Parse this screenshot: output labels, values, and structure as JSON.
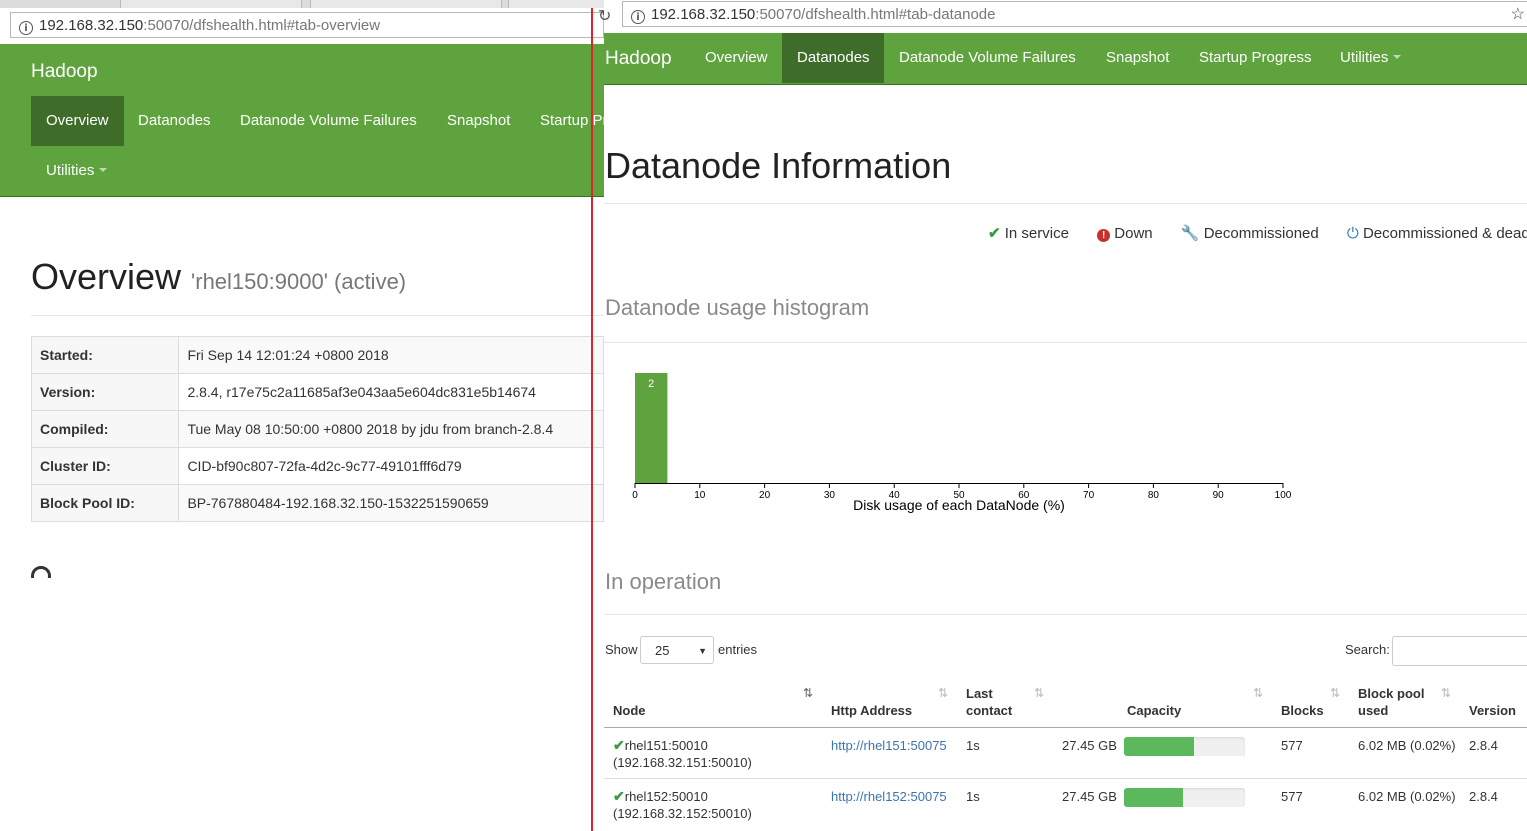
{
  "left": {
    "url_host": "192.168.32.150",
    "url_rest": ":50070/dfshealth.html#tab-overview",
    "brand": "Hadoop",
    "nav": [
      {
        "label": "Overview",
        "active": true
      },
      {
        "label": "Datanodes"
      },
      {
        "label": "Datanode Volume Failures"
      },
      {
        "label": "Snapshot"
      },
      {
        "label": "Startup Pr"
      },
      {
        "label": "Utilities"
      }
    ],
    "title": "Overview",
    "subtitle": "'rhel150:9000' (active)",
    "info": [
      {
        "key": "Started:",
        "value": "Fri Sep 14 12:01:24 +0800 2018"
      },
      {
        "key": "Version:",
        "value": "2.8.4, r17e75c2a11685af3e043aa5e604dc831e5b14674"
      },
      {
        "key": "Compiled:",
        "value": "Tue May 08 10:50:00 +0800 2018 by jdu from branch-2.8.4"
      },
      {
        "key": "Cluster ID:",
        "value": "CID-bf90c807-72fa-4d2c-9c77-49101fff6d79"
      },
      {
        "key": "Block Pool ID:",
        "value": "BP-767880484-192.168.32.150-1532251590659"
      }
    ]
  },
  "right": {
    "url_host": "192.168.32.150",
    "url_rest": ":50070/dfshealth.html#tab-datanode",
    "brand": "Hadoop",
    "nav": [
      {
        "label": "Overview"
      },
      {
        "label": "Datanodes",
        "active": true
      },
      {
        "label": "Datanode Volume Failures"
      },
      {
        "label": "Snapshot"
      },
      {
        "label": "Startup Progress"
      },
      {
        "label": "Utilities"
      }
    ],
    "title": "Datanode Information",
    "legend": {
      "in_service": "In service",
      "down": "Down",
      "decommissioned": "Decommissioned",
      "decommissioned_dead": "Decommissioned & dead"
    },
    "histogram_title": "Datanode usage histogram",
    "in_operation_title": "In operation",
    "table_controls": {
      "show": "Show",
      "page_size": "25",
      "entries": "entries",
      "search": "Search:"
    },
    "columns": {
      "node": "Node",
      "http": "Http Address",
      "last_contact_1": "Last",
      "last_contact_2": "contact",
      "capacity": "Capacity",
      "blocks": "Blocks",
      "bp_used_1": "Block pool",
      "bp_used_2": "used",
      "version": "Version"
    },
    "rows": [
      {
        "node": "rhel151:50010",
        "node_ip": "(192.168.32.151:50010)",
        "http": "http://rhel151:50075",
        "last_contact": "1s",
        "capacity": "27.45 GB",
        "usage_fraction": 0.58,
        "blocks": "577",
        "bp_used": "6.02 MB (0.02%)",
        "version": "2.8.4"
      },
      {
        "node": "rhel152:50010",
        "node_ip": "(192.168.32.152:50010)",
        "http": "http://rhel152:50075",
        "last_contact": "1s",
        "capacity": "27.45 GB",
        "usage_fraction": 0.49,
        "blocks": "577",
        "bp_used": "6.02 MB (0.02%)",
        "version": "2.8.4"
      }
    ]
  },
  "chart_data": {
    "type": "bar",
    "xlabel": "Disk usage of each DataNode (%)",
    "xlim": [
      0,
      100
    ],
    "xticks": [
      0,
      10,
      20,
      30,
      40,
      50,
      60,
      70,
      80,
      90,
      100
    ],
    "bins": [
      {
        "x0": 0,
        "x1": 5,
        "count": 2
      }
    ],
    "bar_color": "#5fa33e"
  }
}
